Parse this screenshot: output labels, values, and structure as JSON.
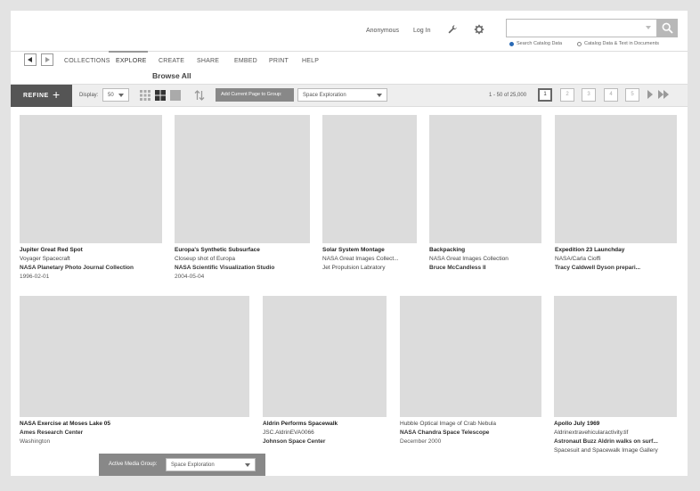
{
  "header": {
    "links": {
      "anonymous": "Anonymous",
      "login": "Log In"
    },
    "icons": {
      "tools": "wrench-icon",
      "settings": "gear-icon",
      "search": "magnifier-icon"
    },
    "search": {
      "value": "",
      "placeholder": ""
    },
    "scope": [
      {
        "label": "Search Catalog Data",
        "selected": true
      },
      {
        "label": "Catalog Data & Text in Documents",
        "selected": false
      }
    ]
  },
  "nav": {
    "tabs": [
      "COLLECTIONS",
      "EXPLORE",
      "CREATE",
      "SHARE",
      "EMBED",
      "PRINT",
      "HELP"
    ],
    "active": "EXPLORE",
    "subtitle": "Browse All"
  },
  "toolbar": {
    "refine": "REFINE",
    "display_label": "Display:",
    "display_value": "50",
    "add_page": "Add Current Page to Group:",
    "group_value": "Space Exploration",
    "range": "1 - 50 of 25,000",
    "pages": [
      "1",
      "2",
      "3",
      "4",
      "5"
    ],
    "current_page": "1"
  },
  "items": [
    {
      "title": "Jupiter Great Red Spot",
      "subtitle": "Voyager Spacecraft",
      "collection": "NASA Planetary Photo Journal Collection",
      "date": "1996-02-01"
    },
    {
      "title": "Europa's Synthetic Subsurface",
      "subtitle": "Closeup shot of Europa",
      "collection": "NASA Scientific Visualization Studio",
      "date": "2004-05-04"
    },
    {
      "title": "Solar System Montage",
      "subtitle": "NASA Great Images Collect...",
      "collection": "Jet Propulsion Labratory",
      "date": ""
    },
    {
      "title": "Backpacking",
      "subtitle": "NASA Great Images Collection",
      "collection": "Bruce McCandless II",
      "date": ""
    },
    {
      "title": "Expedition 23 Launchday",
      "subtitle": "NASA/Carla Cioffi",
      "collection": "Tracy Caldwell Dyson prepari...",
      "date": ""
    },
    {
      "title": "NASA Exercise at Moses Lake 05",
      "subtitle": "",
      "collection": "Ames Research Center",
      "date": "Washington"
    },
    {
      "title": "Aldrin Performs Spacewalk",
      "subtitle": "JSC.AldrinEVA0066",
      "collection": "Johnson Space Center",
      "date": ""
    },
    {
      "title": "",
      "subtitle": "Hubble Optical Image of Crab Nebula",
      "collection": "NASA Chandra Space Telescope",
      "date": "December 2000"
    },
    {
      "title": "Apollo July 1969",
      "subtitle": "Aldrinextravehicularactivity.tif",
      "collection": "Astronaut Buzz Aldrin walks on surf...",
      "date": "Spacesuit and Spacewalk Image Gallery"
    }
  ],
  "active_group": {
    "label": "Active Media Group:",
    "value": "Space Exploration"
  }
}
